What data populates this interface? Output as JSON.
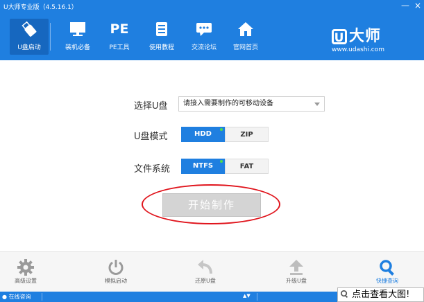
{
  "window": {
    "title": "U大师专业版（4.5.16.1）",
    "minimize": "—",
    "close": "×"
  },
  "nav": [
    {
      "label": "U盘启动",
      "icon": "usb-drive-icon",
      "active": true
    },
    {
      "label": "装机必备",
      "icon": "monitor-icon"
    },
    {
      "label": "PE工具",
      "icon": "pe-text-icon",
      "icon_text": "PE"
    },
    {
      "label": "使用教程",
      "icon": "book-icon"
    },
    {
      "label": "交流论坛",
      "icon": "chat-bubble-icon"
    },
    {
      "label": "官网首页",
      "icon": "home-icon"
    }
  ],
  "brand": {
    "logo_letter": "U",
    "logo_text": "大师",
    "url": "www.udashi.com"
  },
  "form": {
    "select_label": "选择U盘",
    "select_value": "请接入需要制作的可移动设备",
    "mode_label": "U盘模式",
    "mode_options": [
      "HDD",
      "ZIP"
    ],
    "fs_label": "文件系统",
    "fs_options": [
      "NTFS",
      "FAT"
    ],
    "start_button": "开始制作"
  },
  "bottom": [
    {
      "label": "高级设置",
      "icon": "gear-icon"
    },
    {
      "label": "模拟启动",
      "icon": "power-icon"
    },
    {
      "label": "还原U盘",
      "icon": "undo-arrow-icon"
    },
    {
      "label": "升级U盘",
      "icon": "upload-arrow-icon"
    },
    {
      "label": "快捷查询",
      "icon": "magnifier-icon",
      "active": true
    }
  ],
  "status": {
    "online": "在线咨询",
    "caret": "▲▼"
  },
  "overlay": {
    "view_big": "点击查看大图!"
  },
  "colors": {
    "primary": "#1f7fe0",
    "active_nav": "#1667bf",
    "annotation": "#e0141c",
    "indicator": "#4ddc4d"
  }
}
